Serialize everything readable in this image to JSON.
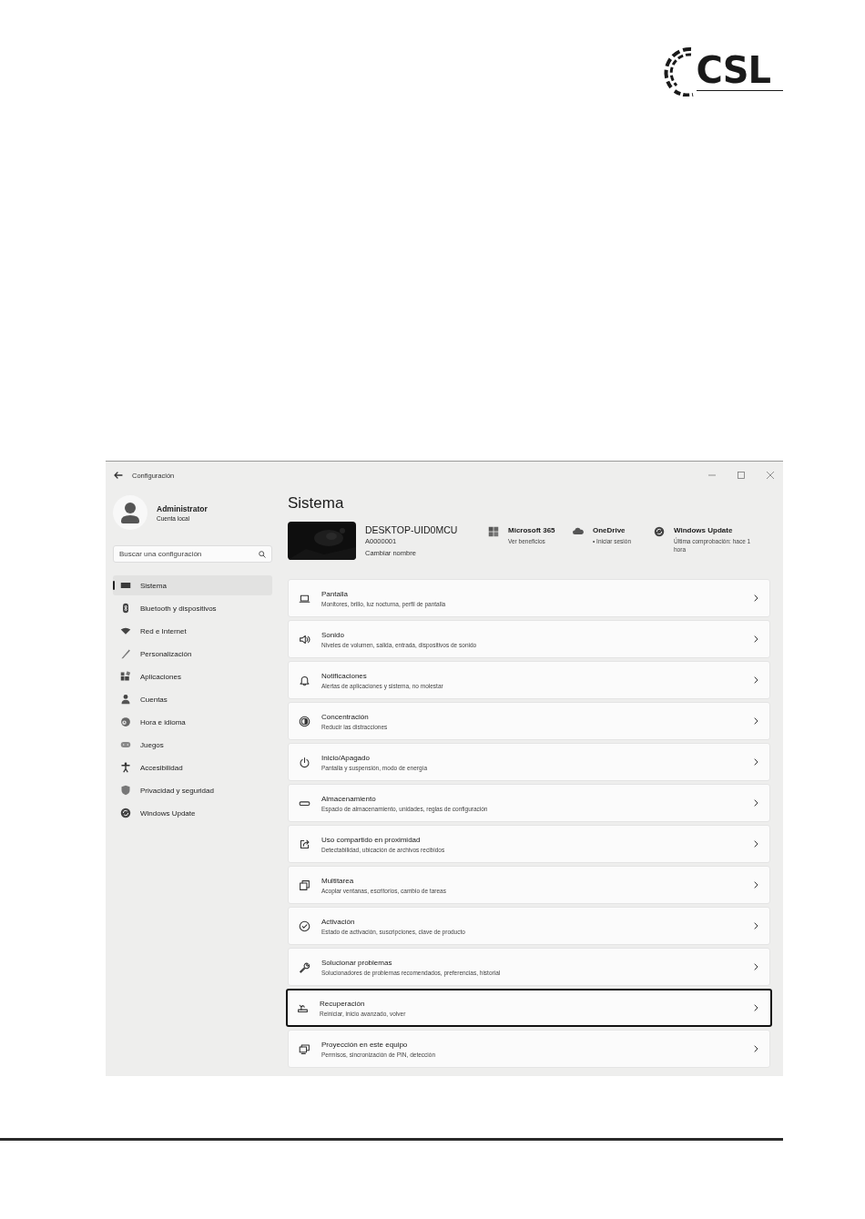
{
  "logo": {
    "text": "CSL"
  },
  "window": {
    "title": "Configuración"
  },
  "profile": {
    "name": "Administrator",
    "account": "Cuenta local"
  },
  "search": {
    "placeholder": "Buscar una configuración"
  },
  "sidebar": {
    "items": [
      {
        "label": "Sistema",
        "selected": true
      },
      {
        "label": "Bluetooth y dispositivos",
        "selected": false
      },
      {
        "label": "Red e Internet",
        "selected": false
      },
      {
        "label": "Personalización",
        "selected": false
      },
      {
        "label": "Aplicaciones",
        "selected": false
      },
      {
        "label": "Cuentas",
        "selected": false
      },
      {
        "label": "Hora e idioma",
        "selected": false
      },
      {
        "label": "Juegos",
        "selected": false
      },
      {
        "label": "Accesibilidad",
        "selected": false
      },
      {
        "label": "Privacidad y seguridad",
        "selected": false
      },
      {
        "label": "Windows Update",
        "selected": false
      }
    ]
  },
  "page_title": "Sistema",
  "device": {
    "name": "DESKTOP-UID0MCU",
    "model": "A0000001",
    "rename_link": "Cambiar nombre"
  },
  "quick_links": [
    {
      "title": "Microsoft 365",
      "subtitle": "Ver beneficios"
    },
    {
      "title": "OneDrive",
      "subtitle": "• Iniciar sesión"
    },
    {
      "title": "Windows Update",
      "subtitle": "Última comprobación: hace 1 hora"
    }
  ],
  "settings": [
    {
      "title": "Pantalla",
      "subtitle": "Monitores, brillo, luz nocturna, perfil de pantalla",
      "selected": false
    },
    {
      "title": "Sonido",
      "subtitle": "Niveles de volumen, salida, entrada, dispositivos de sonido",
      "selected": false
    },
    {
      "title": "Notificaciones",
      "subtitle": "Alertas de aplicaciones y sistema, no molestar",
      "selected": false
    },
    {
      "title": "Concentración",
      "subtitle": "Reducir las distracciones",
      "selected": false
    },
    {
      "title": "Inicio/Apagado",
      "subtitle": "Pantalla y suspensión, modo de energía",
      "selected": false
    },
    {
      "title": "Almacenamiento",
      "subtitle": "Espacio de almacenamiento, unidades, reglas de configuración",
      "selected": false
    },
    {
      "title": "Uso compartido en proximidad",
      "subtitle": "Detectabilidad, ubicación de archivos recibidos",
      "selected": false
    },
    {
      "title": "Multitarea",
      "subtitle": "Acoplar ventanas, escritorios, cambio de tareas",
      "selected": false
    },
    {
      "title": "Activación",
      "subtitle": "Estado de activación, suscripciones, clave de producto",
      "selected": false
    },
    {
      "title": "Solucionar problemas",
      "subtitle": "Solucionadores de problemas recomendados, preferencias, historial",
      "selected": false
    },
    {
      "title": "Recuperación",
      "subtitle": "Reiniciar, inicio avanzado, volver",
      "selected": true
    },
    {
      "title": "Proyección en este equipo",
      "subtitle": "Permisos, sincronización de PIN, detección",
      "selected": false
    }
  ]
}
